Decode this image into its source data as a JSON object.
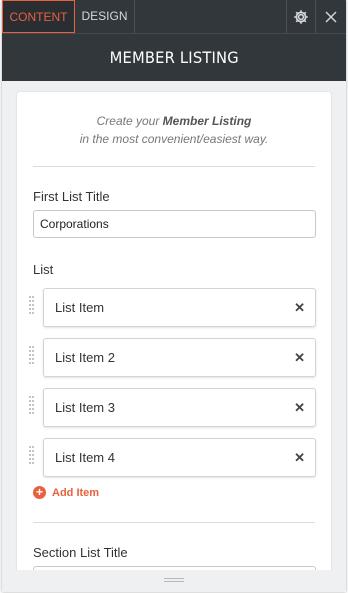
{
  "tabs": {
    "content": "CONTENT",
    "design": "DESIGN"
  },
  "header": {
    "title": "MEMBER LISTING"
  },
  "intro": {
    "prefix": "Create your ",
    "emphasis": "Member Listing",
    "suffix": " in the most convenient/easiest way."
  },
  "first_list": {
    "label": "First List Title",
    "value": "Corporations"
  },
  "list": {
    "label": "List",
    "items": [
      {
        "label": "List Item"
      },
      {
        "label": "List Item 2"
      },
      {
        "label": "List Item 3"
      },
      {
        "label": "List Item 4"
      }
    ],
    "add_label": "Add Item"
  },
  "section_list": {
    "label": "Section List Title"
  },
  "icons": {
    "settings": "gear-icon",
    "close": "close-icon",
    "remove": "close-x-icon",
    "add": "plus-circle-icon",
    "drag": "drag-handle-icon",
    "resize": "resize-grip-icon"
  },
  "colors": {
    "accent": "#e8613d",
    "toolbar": "#32373c",
    "panel": "#eef0f1"
  }
}
